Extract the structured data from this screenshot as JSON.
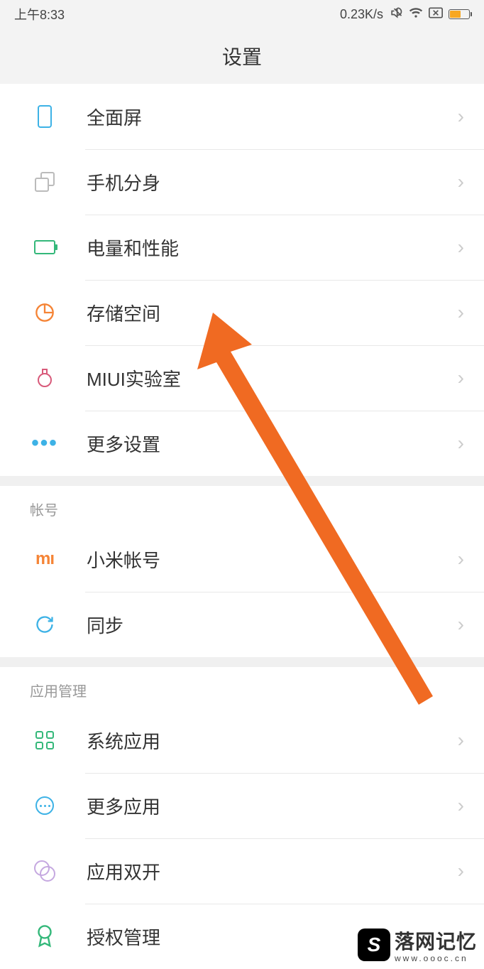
{
  "status": {
    "time": "上午8:33",
    "speed": "0.23K/s"
  },
  "header": {
    "title": "设置"
  },
  "sections": {
    "s1": {
      "items": [
        {
          "id": "fullscreen",
          "label": "全面屏"
        },
        {
          "id": "second-space",
          "label": "手机分身"
        },
        {
          "id": "battery-perf",
          "label": "电量和性能"
        },
        {
          "id": "storage",
          "label": "存储空间"
        },
        {
          "id": "miui-lab",
          "label": "MIUI实验室"
        },
        {
          "id": "more-settings",
          "label": "更多设置"
        }
      ]
    },
    "accounts": {
      "header": "帐号",
      "items": [
        {
          "id": "mi-account",
          "label": "小米帐号"
        },
        {
          "id": "sync",
          "label": "同步"
        }
      ]
    },
    "apps": {
      "header": "应用管理",
      "items": [
        {
          "id": "system-apps",
          "label": "系统应用"
        },
        {
          "id": "more-apps",
          "label": "更多应用"
        },
        {
          "id": "dual-apps",
          "label": "应用双开"
        },
        {
          "id": "permissions",
          "label": "授权管理"
        }
      ]
    }
  },
  "watermark": {
    "title": "落网记忆",
    "url": "www.oooc.cn"
  }
}
